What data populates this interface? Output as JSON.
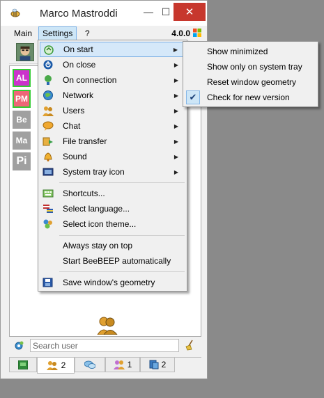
{
  "window": {
    "title": "Marco Mastroddi",
    "minimize_glyph": "—",
    "maximize_glyph": "☐",
    "close_glyph": "✕"
  },
  "menubar": {
    "main": "Main",
    "settings": "Settings",
    "help": "?",
    "version": "4.0.0"
  },
  "users": [
    {
      "initials": "AL",
      "color": "#cc33cc",
      "border": "#33cc33"
    },
    {
      "initials": "PM",
      "color": "#ee6677",
      "border": "#33cc33"
    },
    {
      "initials": "Be",
      "color": "#a0a0a0",
      "border": "#a0a0a0"
    },
    {
      "initials": "Ma",
      "color": "#a0a0a0",
      "border": "#a0a0a0"
    },
    {
      "initials": "Pi",
      "color": "#a0a0a0",
      "border": "#a0a0a0"
    }
  ],
  "search": {
    "placeholder": "Search user"
  },
  "tabs": [
    {
      "icon": "chat-window-icon",
      "count": ""
    },
    {
      "icon": "users-icon",
      "count": "2"
    },
    {
      "icon": "chat-bubbles-icon",
      "count": ""
    },
    {
      "icon": "groups-icon",
      "count": "1"
    },
    {
      "icon": "file-share-icon",
      "count": "2"
    }
  ],
  "settings_menu": {
    "on_start": "On start",
    "on_close": "On close",
    "on_connection": "On connection",
    "network": "Network",
    "users": "Users",
    "chat": "Chat",
    "file_transfer": "File transfer",
    "sound": "Sound",
    "system_tray_icon": "System tray icon",
    "shortcuts": "Shortcuts...",
    "select_language": "Select language...",
    "select_icon_theme": "Select icon theme...",
    "always_on_top": "Always stay on top",
    "start_automatically": "Start BeeBEEP automatically",
    "save_geometry": "Save window's geometry"
  },
  "on_start_submenu": {
    "show_minimized": "Show minimized",
    "show_only_tray": "Show only on system tray",
    "reset_geometry": "Reset window geometry",
    "check_version": "Check for new version",
    "check_version_checked": true,
    "check_glyph": "✔"
  },
  "colors": {
    "highlight": "#d5e8f9",
    "close_button": "#c7372d",
    "desktop": "#8a8a8a"
  }
}
